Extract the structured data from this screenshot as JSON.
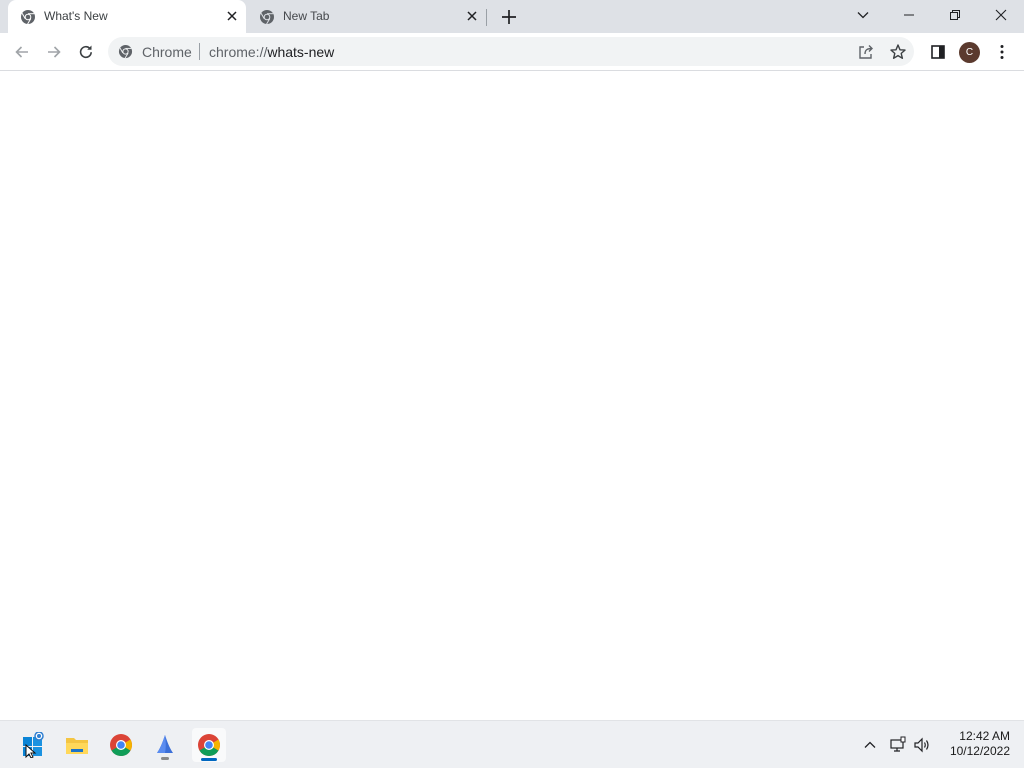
{
  "tabs": [
    {
      "title": "What's New",
      "active": true,
      "icon": "chrome-favicon-icon"
    },
    {
      "title": "New Tab",
      "active": false,
      "icon": "chrome-favicon-icon"
    }
  ],
  "window_controls": {
    "tab_search": "chevron-down-icon",
    "minimize": "minimize-icon",
    "restore": "restore-icon",
    "close": "close-icon"
  },
  "toolbar": {
    "omnibox": {
      "chip_label": "Chrome",
      "url_scheme": "chrome://",
      "url_path": "whats-new"
    },
    "profile_initial": "C"
  },
  "taskbar": {
    "apps": [
      "start-icon",
      "file-explorer-icon",
      "chrome-icon",
      "app-sail-icon",
      "chrome-icon"
    ],
    "clock": {
      "time": "12:42 AM",
      "date": "10/12/2022"
    }
  },
  "colors": {
    "tabstrip_bg": "#dee1e6",
    "omnibox_bg": "#f1f3f4",
    "avatar_bg": "#5b3a2e",
    "taskbar_accent": "#0067c0"
  }
}
